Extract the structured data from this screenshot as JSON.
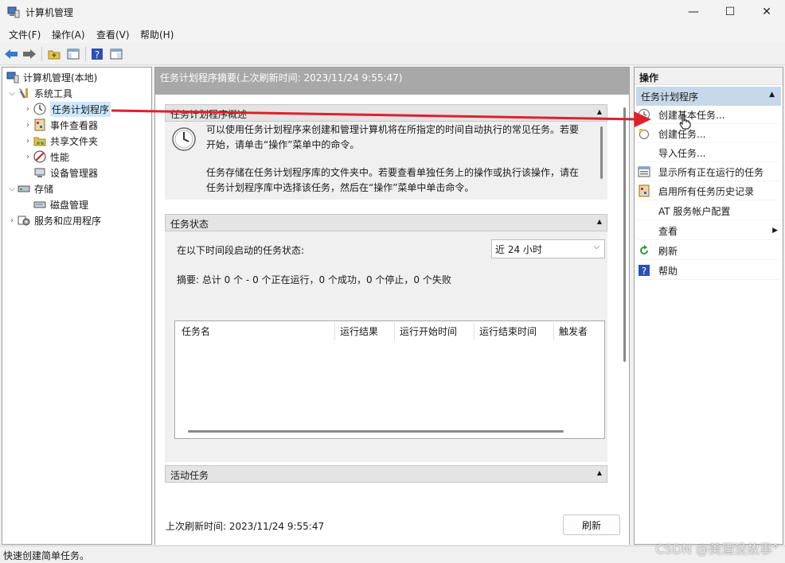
{
  "window": {
    "title": "计算机管理",
    "controls": [
      "—",
      "☐",
      "✕"
    ]
  },
  "menu": [
    "文件(F)",
    "操作(A)",
    "查看(V)",
    "帮助(H)"
  ],
  "tree": {
    "root": "计算机管理(本地)",
    "items": [
      {
        "label": "系统工具"
      },
      {
        "label": "任务计划程序"
      },
      {
        "label": "事件查看器"
      },
      {
        "label": "共享文件夹"
      },
      {
        "label": "性能"
      },
      {
        "label": "设备管理器"
      },
      {
        "label": "存储"
      },
      {
        "label": "磁盘管理"
      },
      {
        "label": "服务和应用程序"
      }
    ]
  },
  "center": {
    "header": "任务计划程序摘要(上次刷新时间: 2023/11/24 9:55:47)",
    "overview": {
      "title": "任务计划程序概述",
      "para1_line1": "可以使用任务计划程序来创建和管理计算机将在所指定的时间自动执行的常见任务。若要",
      "para1_line2": "开始，请单击“操作”菜单中的命令。",
      "para2_line1": "任务存储在任务计划程序库的文件夹中。若要查看单独任务上的操作或执行该操作，请在",
      "para2_line2": "任务计划程序库中选择该任务，然后在“操作”菜单中单击命令。"
    },
    "status": {
      "title": "任务状态",
      "period_label": "在以下时间段启动的任务状态:",
      "period_value": "近 24 小时",
      "summary": "摘要: 总计 0 个 - 0 个正在运行，0 个成功，0 个停止，0 个失败",
      "columns": [
        "任务名",
        "运行结果",
        "运行开始时间",
        "运行结束时间",
        "触发者"
      ]
    },
    "active": {
      "title": "活动任务"
    },
    "footer": {
      "last_refresh": "上次刷新时间: 2023/11/24 9:55:47",
      "refresh_label": "刷新"
    }
  },
  "actions": {
    "title": "操作",
    "group": "任务计划程序",
    "items": [
      {
        "label": "创建基本任务..."
      },
      {
        "label": "创建任务..."
      },
      {
        "label": "导入任务..."
      },
      {
        "label": "显示所有正在运行的任务"
      },
      {
        "label": "启用所有任务历史记录"
      },
      {
        "label": "AT 服务帐户配置"
      },
      {
        "label": "查看"
      },
      {
        "label": "刷新"
      },
      {
        "label": "帮助"
      }
    ]
  },
  "statusbar": "快速创建简单任务。",
  "watermark": "CSDN @美酒没故事°",
  "colors": {
    "annotation_arrow": "#e0202a",
    "selection": "#cce8ff",
    "action_group": "#c6d8ea"
  }
}
